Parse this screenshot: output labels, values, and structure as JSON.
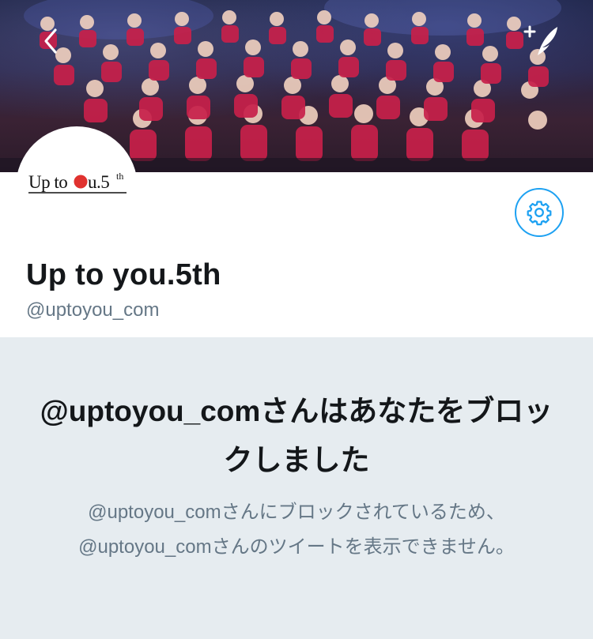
{
  "banner": {
    "back_icon": "chevron-left-icon",
    "compose_icon": "compose-tweet-icon"
  },
  "avatar": {
    "logo_text": "Up to you.5th"
  },
  "settings": {
    "icon": "gear-icon",
    "accent_color": "#1DA1F2"
  },
  "profile": {
    "display_name": "Up to you.5th",
    "handle": "@uptoyou_com"
  },
  "blocked": {
    "title": "@uptoyou_comさんはあなたをブロックしました",
    "description": "@uptoyou_comさんにブロックされているため、@uptoyou_comさんのツイートを表示できません。"
  }
}
